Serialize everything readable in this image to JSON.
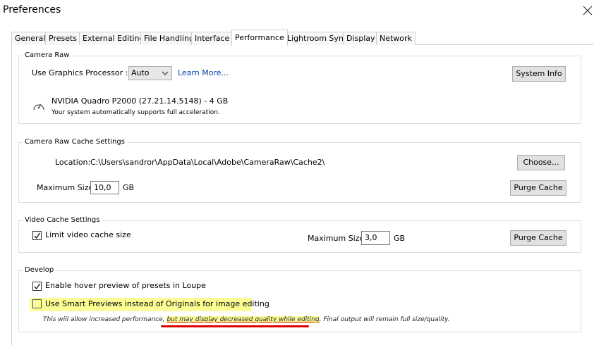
{
  "window": {
    "title": "Preferences"
  },
  "tabs": [
    "General",
    "Presets",
    "External Editing",
    "File Handling",
    "Interface",
    "Performance",
    "Lightroom Sync",
    "Display",
    "Network"
  ],
  "camera_raw": {
    "title": "Camera Raw",
    "gpu_label": "Use Graphics Processor :",
    "gpu_value": "Auto",
    "learn_more": "Learn More...",
    "system_info": "System Info",
    "gpu_name": "NVIDIA Quadro P2000 (27.21.14.5148) - 4 GB",
    "gpu_status": "Your system automatically supports full acceleration."
  },
  "camera_raw_cache": {
    "title": "Camera Raw Cache Settings",
    "location_label": "Location:",
    "location_value": "C:\\Users\\sandror\\AppData\\Local\\Adobe\\CameraRaw\\Cache2\\",
    "choose": "Choose...",
    "max_label": "Maximum Size:",
    "max_value": "10,0",
    "unit": "GB",
    "purge": "Purge Cache"
  },
  "video_cache": {
    "title": "Video Cache Settings",
    "limit_label": "Limit video cache size",
    "max_label": "Maximum Size:",
    "max_value": "3,0",
    "unit": "GB",
    "purge": "Purge Cache"
  },
  "develop": {
    "title": "Develop",
    "hover_label": "Enable hover preview of presets in Loupe",
    "smart_label": "Use Smart Previews instead of Originals for image editing",
    "note_a": "This will allow increased performance,",
    "note_b": "but may display decreased quality while editing",
    "note_c": ". Final output will remain full size/quality."
  },
  "colors": {
    "highlight": "#fdfd96",
    "underline": "#e00000",
    "link": "#0645ad"
  }
}
